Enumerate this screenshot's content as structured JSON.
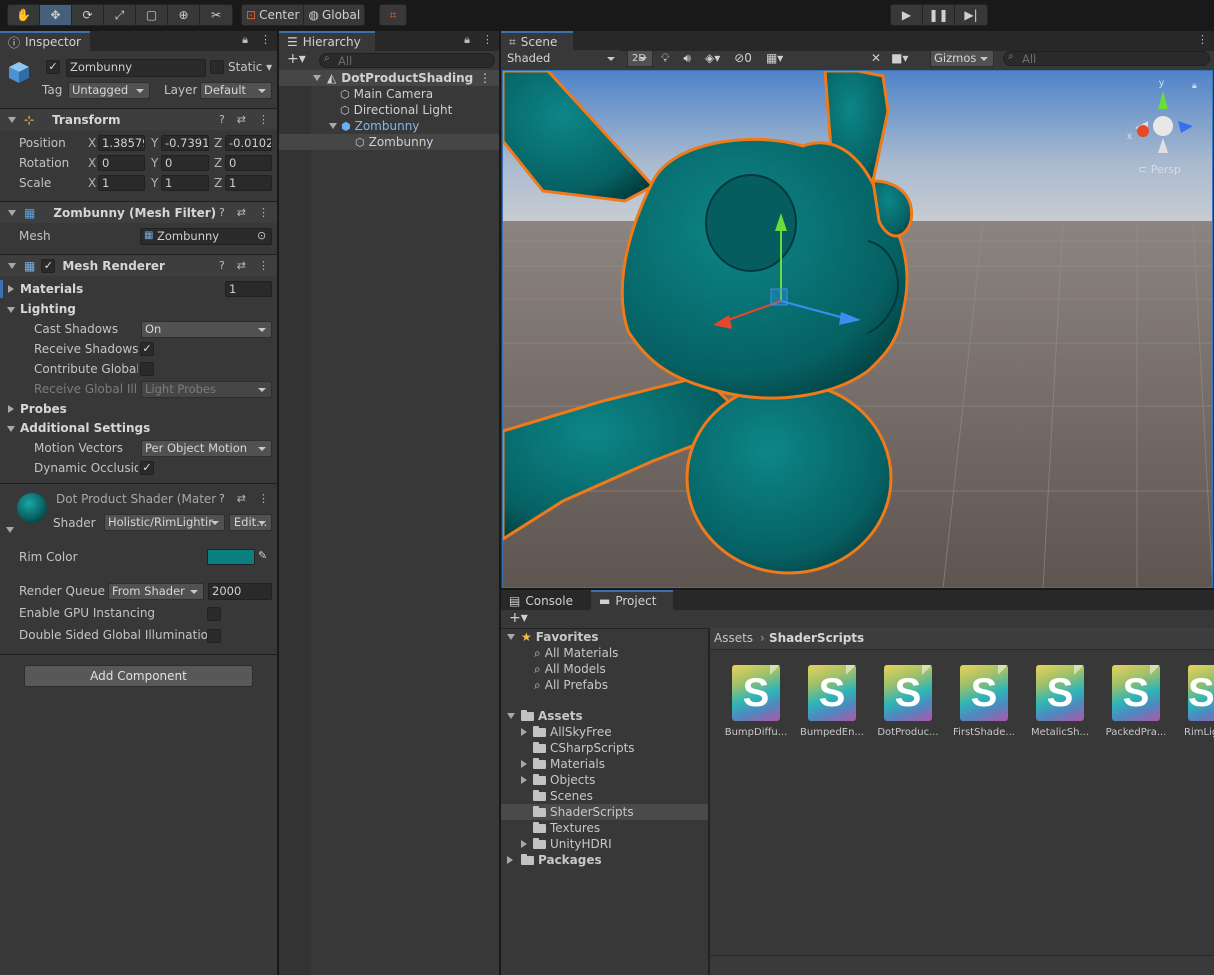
{
  "toolbar": {
    "pivot_label": "Center",
    "space_label": "Global"
  },
  "inspector": {
    "tab": "Inspector",
    "object_name": "Zombunny",
    "static_label": "Static",
    "tag_label": "Tag",
    "tag_value": "Untagged",
    "layer_label": "Layer",
    "layer_value": "Default",
    "transform": {
      "title": "Transform",
      "position_label": "Position",
      "rotation_label": "Rotation",
      "scale_label": "Scale",
      "position": [
        "1.38579",
        "-0.7391",
        "-0.0102"
      ],
      "rotation": [
        "0",
        "0",
        "0"
      ],
      "scale": [
        "1",
        "1",
        "1"
      ],
      "x": "X",
      "y": "Y",
      "z": "Z"
    },
    "mesh_filter": {
      "title": "Zombunny (Mesh Filter)",
      "mesh_label": "Mesh",
      "mesh_value": "Zombunny"
    },
    "mesh_renderer": {
      "title": "Mesh Renderer",
      "materials_label": "Materials",
      "materials_count": "1",
      "lighting_label": "Lighting",
      "cast_shadows_label": "Cast Shadows",
      "cast_shadows_value": "On",
      "receive_shadows_label": "Receive Shadows",
      "contribute_gi_label": "Contribute Global I",
      "receive_gi_label": "Receive Global Illu",
      "receive_gi_value": "Light Probes",
      "probes_label": "Probes",
      "additional_label": "Additional Settings",
      "motion_vectors_label": "Motion Vectors",
      "motion_vectors_value": "Per Object Motion",
      "dynamic_occlusion_label": "Dynamic Occlusio"
    },
    "material": {
      "title": "Dot Product Shader (Mater",
      "shader_label": "Shader",
      "shader_value": "Holistic/RimLightir",
      "edit_label": "Edit...",
      "rim_color_label": "Rim Color",
      "rim_color": "#0a7f80",
      "render_queue_label": "Render Queue",
      "render_queue_mode": "From Shader",
      "render_queue_value": "2000",
      "gpu_instancing_label": "Enable GPU Instancing",
      "double_sided_gi_label": "Double Sided Global Illumination"
    },
    "add_component": "Add Component"
  },
  "hierarchy": {
    "tab": "Hierarchy",
    "search_placeholder": "All",
    "scene": "DotProductShading",
    "items": [
      "Main Camera",
      "Directional Light",
      "Zombunny",
      "Zombunny"
    ]
  },
  "scene_view": {
    "tab": "Scene",
    "draw_mode": "Shaded",
    "mode_2d": "2D",
    "hidden_count": "0",
    "gizmos": "Gizmos",
    "search_placeholder": "All",
    "persp_label": "Persp",
    "gizmo_x": "x",
    "gizmo_y": "y",
    "mesh_color": "#076a6c",
    "outline_color": "#f07a1a"
  },
  "project": {
    "console_tab": "Console",
    "project_tab": "Project",
    "favorites_label": "Favorites",
    "favorites": [
      "All Materials",
      "All Models",
      "All Prefabs"
    ],
    "assets_label": "Assets",
    "folders": [
      "AllSkyFree",
      "CSharpScripts",
      "Materials",
      "Objects",
      "Scenes",
      "ShaderScripts",
      "Textures",
      "UnityHDRI"
    ],
    "packages_label": "Packages",
    "breadcrumb": [
      "Assets",
      "ShaderScripts"
    ],
    "files": [
      "BumpDiffu...",
      "BumpedEn...",
      "DotProduc...",
      "FirstShade...",
      "MetalicSh...",
      "PackedPra...",
      "RimLig"
    ]
  }
}
